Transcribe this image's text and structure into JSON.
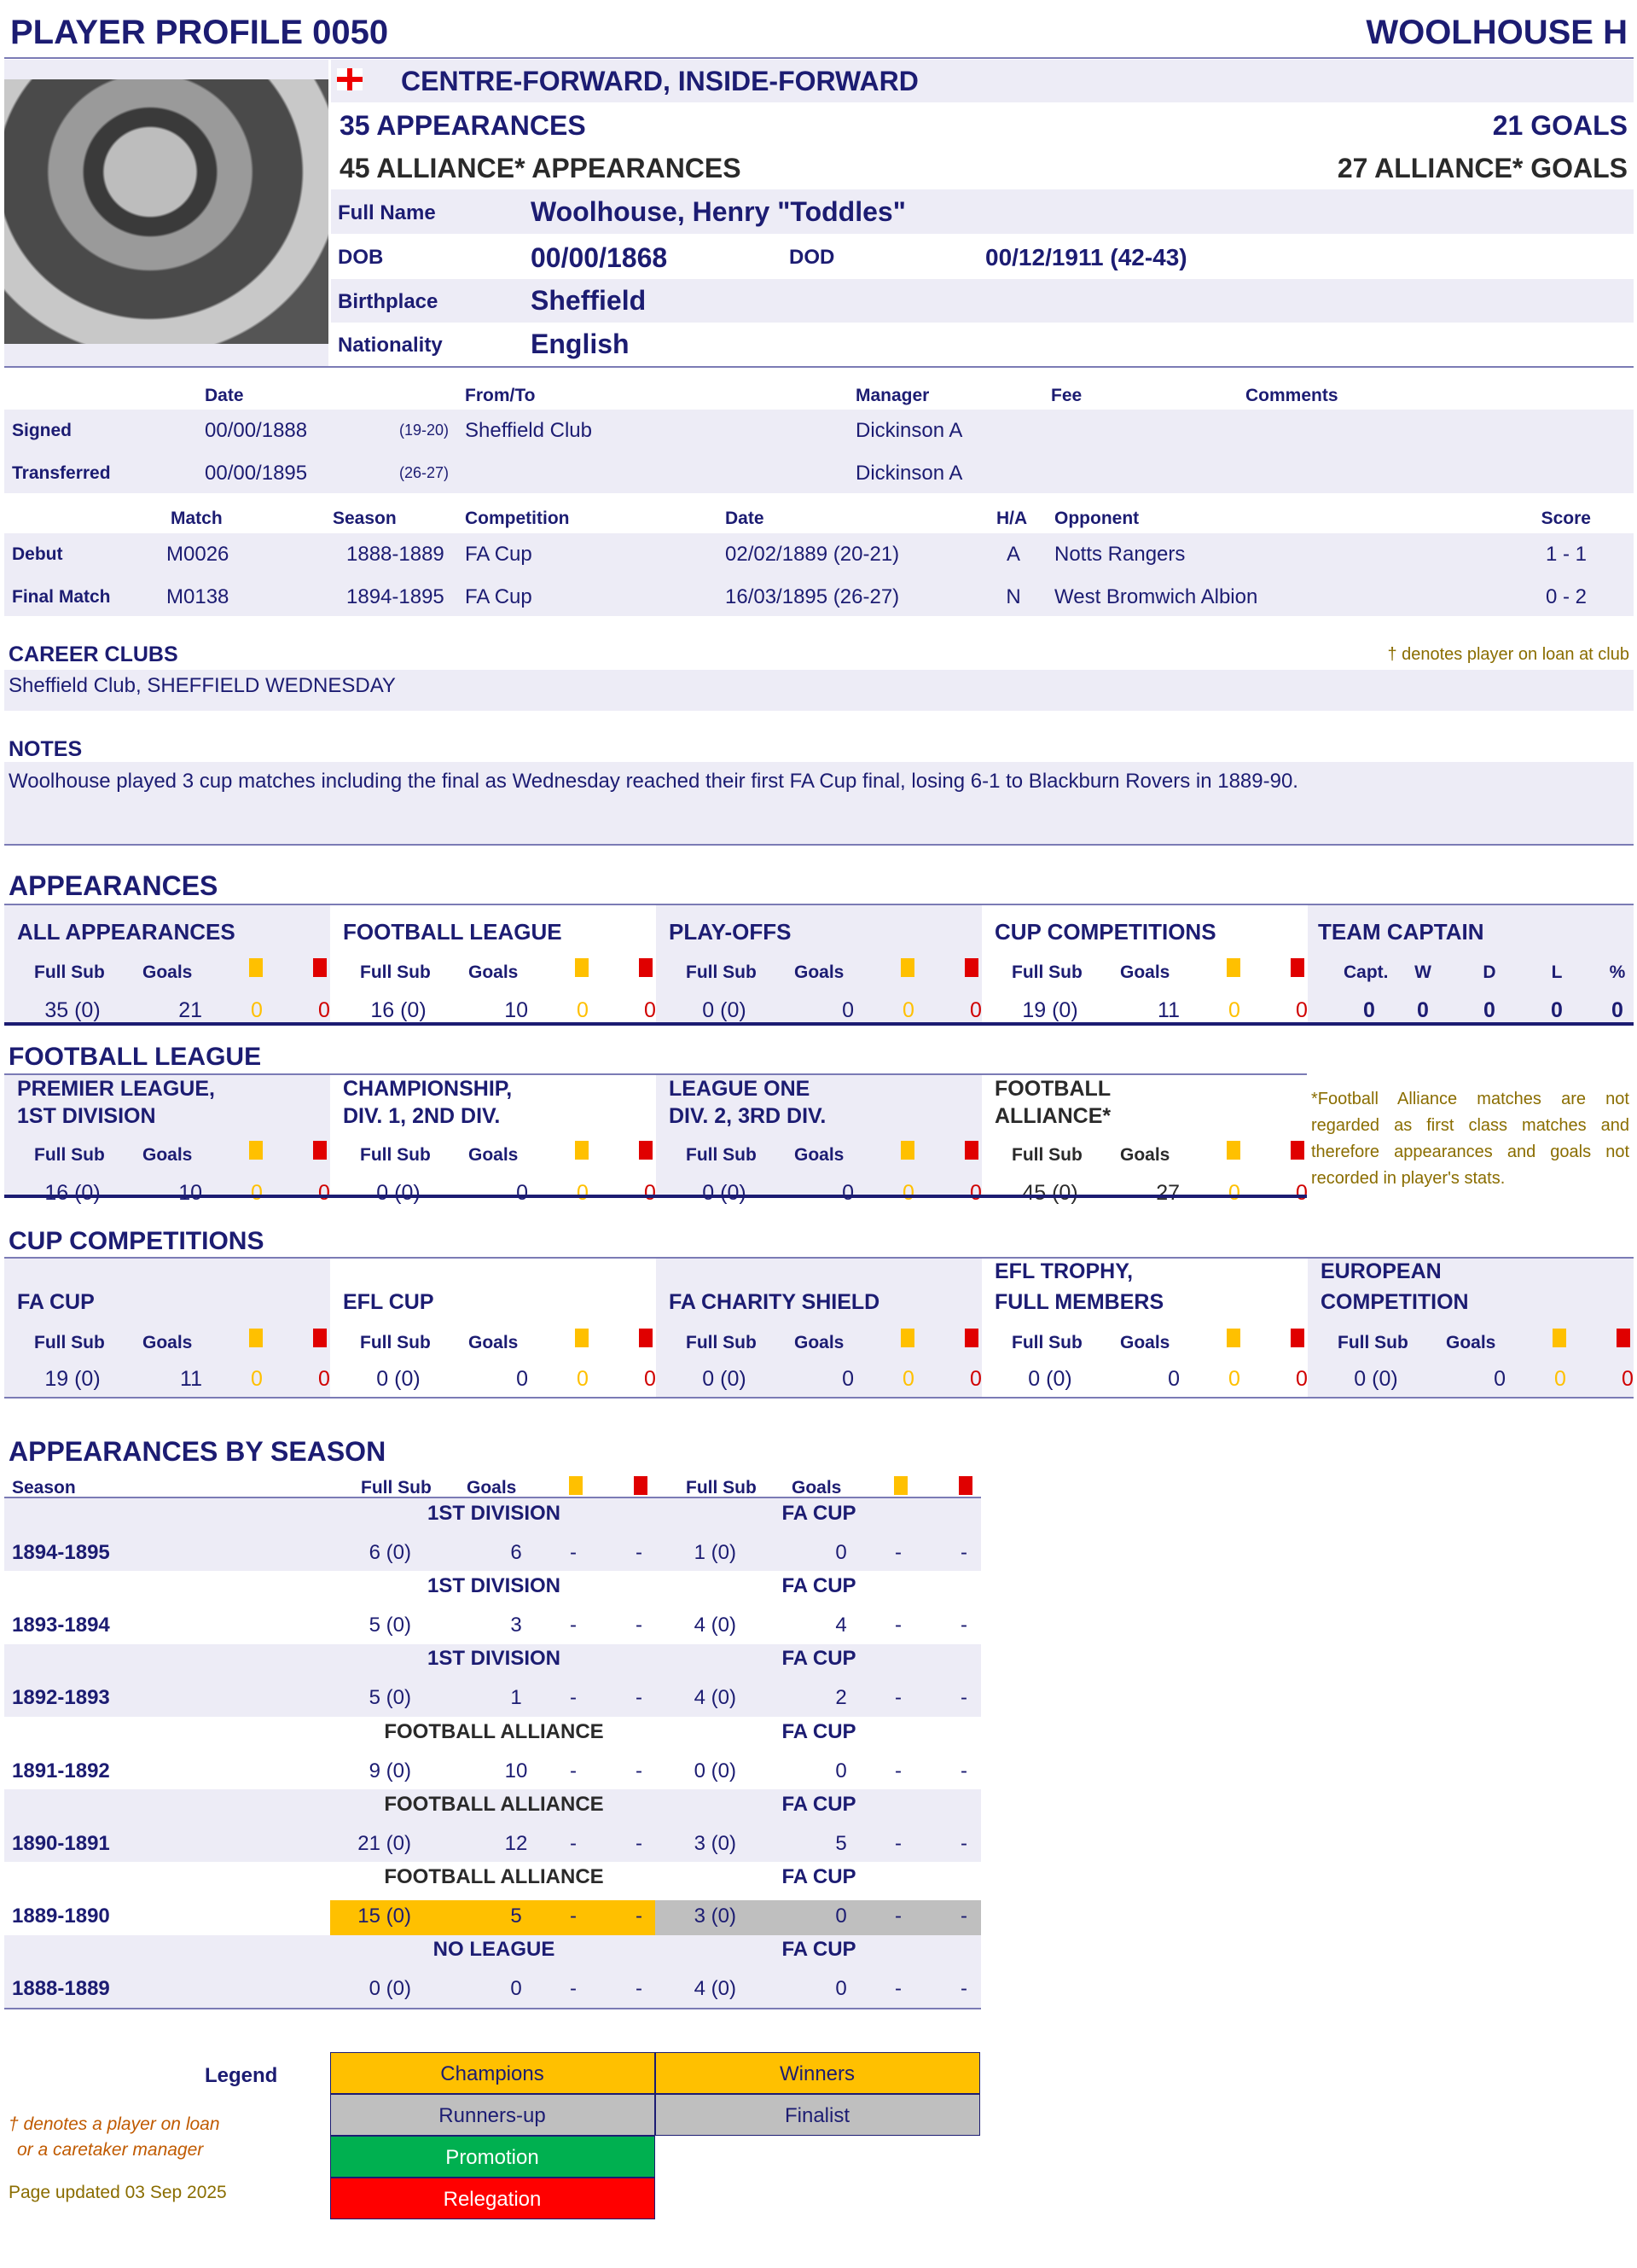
{
  "header": {
    "title": "PLAYER PROFILE 0050",
    "player": "WOOLHOUSE H"
  },
  "profile": {
    "flag": "england-flag",
    "position": "CENTRE-FORWARD, INSIDE-FORWARD",
    "appearances": "35 APPEARANCES",
    "goals": "21 GOALS",
    "alliance_appearances": "45 ALLIANCE* APPEARANCES",
    "alliance_goals": "27 ALLIANCE* GOALS",
    "labels": {
      "full_name": "Full Name",
      "dob": "DOB",
      "dod": "DOD",
      "birthplace": "Birthplace",
      "nationality": "Nationality"
    },
    "full_name": "Woolhouse, Henry \"Toddles\"",
    "dob": "00/00/1868",
    "dod": "00/12/1911  (42-43)",
    "birthplace": "Sheffield",
    "nationality": "English"
  },
  "transfers": {
    "headers": [
      "Date",
      "From/To",
      "Manager",
      "Fee",
      "Comments"
    ],
    "rows": [
      {
        "label": "Signed",
        "date": "00/00/1888",
        "age": "(19-20)",
        "club": "Sheffield Club",
        "manager": "Dickinson A"
      },
      {
        "label": "Transferred",
        "date": "00/00/1895",
        "age": "(26-27)",
        "club": "",
        "manager": "Dickinson A"
      }
    ]
  },
  "matches": {
    "headers": [
      "Match",
      "Season",
      "Competition",
      "Date",
      "H/A",
      "Opponent",
      "Score"
    ],
    "rows": [
      {
        "label": "Debut",
        "match": "M0026",
        "season": "1888-1889",
        "competition": "FA Cup",
        "date": "02/02/1889  (20-21)",
        "ha": "A",
        "opponent": "Notts Rangers",
        "score": "1 - 1"
      },
      {
        "label": "Final Match",
        "match": "M0138",
        "season": "1894-1895",
        "competition": "FA Cup",
        "date": "16/03/1895  (26-27)",
        "ha": "N",
        "opponent": "West Bromwich Albion",
        "score": "0 - 2"
      }
    ]
  },
  "career_clubs": {
    "title": "CAREER CLUBS",
    "text": "Sheffield Club, SHEFFIELD WEDNESDAY",
    "loan_note": "† denotes player on loan at club"
  },
  "notes": {
    "title": "NOTES",
    "text": "Woolhouse played 3 cup matches including the final as Wednesday reached their first FA Cup final, losing 6-1 to Blackburn Rovers in 1889-90."
  },
  "labels": {
    "full_sub": "Full  Sub",
    "goals": "Goals"
  },
  "appearances": {
    "title": "APPEARANCES",
    "groups": [
      {
        "title": "ALL APPEARANCES",
        "apps": "35 (0)",
        "goals": "21",
        "yellow": "0",
        "red": "0"
      },
      {
        "title": "FOOTBALL LEAGUE",
        "apps": "16 (0)",
        "goals": "10",
        "yellow": "0",
        "red": "0"
      },
      {
        "title": "PLAY-OFFS",
        "apps": "0 (0)",
        "goals": "0",
        "yellow": "0",
        "red": "0"
      },
      {
        "title": "CUP COMPETITIONS",
        "apps": "19 (0)",
        "goals": "11",
        "yellow": "0",
        "red": "0"
      }
    ],
    "captain": {
      "title": "TEAM CAPTAIN",
      "headers": [
        "Capt.",
        "W",
        "D",
        "L",
        "%"
      ],
      "values": [
        "0",
        "0",
        "0",
        "0",
        "0"
      ]
    }
  },
  "football_league": {
    "title": "FOOTBALL LEAGUE",
    "groups": [
      {
        "title1": "PREMIER LEAGUE,",
        "title2": "1ST DIVISION",
        "apps": "16 (0)",
        "goals": "10",
        "yellow": "0",
        "red": "0"
      },
      {
        "title1": "CHAMPIONSHIP,",
        "title2": "DIV. 1, 2ND DIV.",
        "apps": "0 (0)",
        "goals": "0",
        "yellow": "0",
        "red": "0"
      },
      {
        "title1": "LEAGUE ONE",
        "title2": "DIV. 2, 3RD DIV.",
        "apps": "0 (0)",
        "goals": "0",
        "yellow": "0",
        "red": "0"
      },
      {
        "title1": "FOOTBALL",
        "title2": "ALLIANCE*",
        "apps": "45 (0)",
        "goals": "27",
        "yellow": "0",
        "red": "0",
        "dark": true
      }
    ],
    "note": "*Football Alliance matches are not regarded as first class matches and therefore appearances and goals not recorded in player's stats."
  },
  "cup_competitions": {
    "title": "CUP COMPETITIONS",
    "groups": [
      {
        "title1": "",
        "title2": "FA CUP",
        "apps": "19 (0)",
        "goals": "11",
        "yellow": "0",
        "red": "0"
      },
      {
        "title1": "",
        "title2": "EFL CUP",
        "apps": "0 (0)",
        "goals": "0",
        "yellow": "0",
        "red": "0"
      },
      {
        "title1": "",
        "title2": "FA CHARITY SHIELD",
        "apps": "0 (0)",
        "goals": "0",
        "yellow": "0",
        "red": "0"
      },
      {
        "title1": "EFL TROPHY,",
        "title2": "FULL MEMBERS",
        "apps": "0 (0)",
        "goals": "0",
        "yellow": "0",
        "red": "0"
      },
      {
        "title1": "EUROPEAN",
        "title2": "COMPETITION",
        "apps": "0 (0)",
        "goals": "0",
        "yellow": "0",
        "red": "0"
      }
    ]
  },
  "by_season": {
    "title": "APPEARANCES BY SEASON",
    "season_header": "Season",
    "rows": [
      {
        "season": "1894-1895",
        "league": {
          "name": "1ST DIVISION",
          "apps": "6 (0)",
          "goals": "6",
          "y": "-",
          "r": "-"
        },
        "cup": {
          "name": "FA CUP",
          "apps": "1 (0)",
          "goals": "0",
          "y": "-",
          "r": "-"
        }
      },
      {
        "season": "1893-1894",
        "league": {
          "name": "1ST DIVISION",
          "apps": "5 (0)",
          "goals": "3",
          "y": "-",
          "r": "-"
        },
        "cup": {
          "name": "FA CUP",
          "apps": "4 (0)",
          "goals": "4",
          "y": "-",
          "r": "-"
        }
      },
      {
        "season": "1892-1893",
        "league": {
          "name": "1ST DIVISION",
          "apps": "5 (0)",
          "goals": "1",
          "y": "-",
          "r": "-"
        },
        "cup": {
          "name": "FA CUP",
          "apps": "4 (0)",
          "goals": "2",
          "y": "-",
          "r": "-"
        }
      },
      {
        "season": "1891-1892",
        "league": {
          "name": "FOOTBALL ALLIANCE",
          "apps": "9 (0)",
          "goals": "10",
          "y": "-",
          "r": "-",
          "dark": true
        },
        "cup": {
          "name": "FA CUP",
          "apps": "0 (0)",
          "goals": "0",
          "y": "-",
          "r": "-"
        }
      },
      {
        "season": "1890-1891",
        "league": {
          "name": "FOOTBALL ALLIANCE",
          "apps": "21 (0)",
          "goals": "12",
          "y": "-",
          "r": "-",
          "dark": true
        },
        "cup": {
          "name": "FA CUP",
          "apps": "3 (0)",
          "goals": "5",
          "y": "-",
          "r": "-"
        }
      },
      {
        "season": "1889-1890",
        "league": {
          "name": "FOOTBALL ALLIANCE",
          "apps": "15 (0)",
          "goals": "5",
          "y": "-",
          "r": "-",
          "dark": true,
          "highlight": "#ffc000"
        },
        "cup": {
          "name": "FA CUP",
          "apps": "3 (0)",
          "goals": "0",
          "y": "-",
          "r": "-",
          "highlight": "#bfbfbf"
        }
      },
      {
        "season": "1888-1889",
        "league": {
          "name": "NO LEAGUE",
          "apps": "0 (0)",
          "goals": "0",
          "y": "-",
          "r": "-"
        },
        "cup": {
          "name": "FA CUP",
          "apps": "4 (0)",
          "goals": "0",
          "y": "-",
          "r": "-"
        }
      }
    ]
  },
  "legend": {
    "label": "Legend",
    "items": [
      {
        "label": "Champions",
        "color": "#ffc000",
        "text": "#1c1c72"
      },
      {
        "label": "Winners",
        "color": "#ffc000",
        "text": "#1c1c72"
      },
      {
        "label": "Runners-up",
        "color": "#bfbfbf",
        "text": "#1c1c72"
      },
      {
        "label": "Finalist",
        "color": "#bfbfbf",
        "text": "#1c1c72"
      },
      {
        "label": "Promotion",
        "color": "#00b050",
        "text": "#ffffff"
      },
      {
        "label": "Relegation",
        "color": "#ff0000",
        "text": "#ffffff"
      }
    ],
    "loan_note_1": "† denotes a player on loan",
    "loan_note_2": "or a caretaker manager",
    "updated": "Page updated 03 Sep 2025"
  },
  "colors": {
    "navy": "#1c1c72",
    "panel": "#edecf6",
    "yellow_card": "#ffc000",
    "red_card": "#e00000",
    "note": "#8a6d00"
  }
}
